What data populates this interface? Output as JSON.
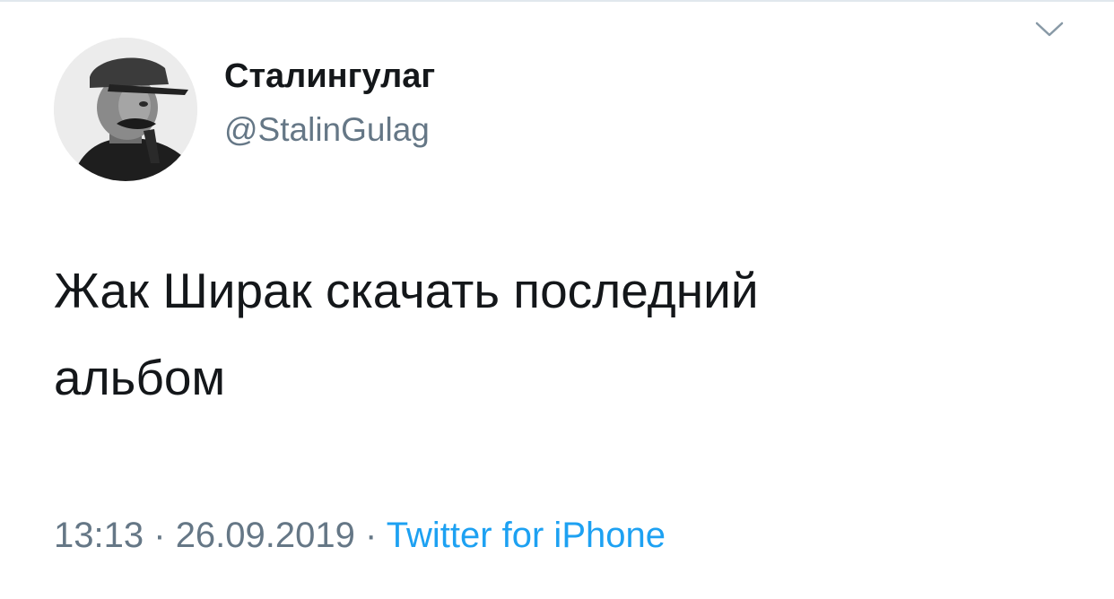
{
  "tweet": {
    "user": {
      "display_name": "Сталингулаг",
      "handle": "@StalinGulag"
    },
    "text_line1": "Жак Ширак скачать последний",
    "text_line2": "альбом",
    "time": "13:13",
    "separator": "·",
    "date": "26.09.2019",
    "source": "Twitter for iPhone"
  },
  "icons": {
    "menu": "chevron-down-icon",
    "avatar": "avatar"
  },
  "colors": {
    "name": "#14171a",
    "secondary": "#657786",
    "link": "#1da1f2",
    "border": "#e1e8ed"
  }
}
